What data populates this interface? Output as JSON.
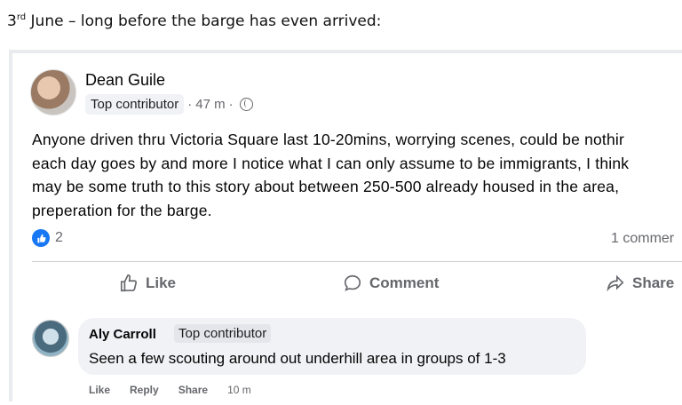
{
  "caption": {
    "date": "3",
    "suffix": "rd",
    "rest": " June – long before the barge has even arrived:"
  },
  "post": {
    "author": "Dean Guile",
    "badge": "Top contributor",
    "time": "47 m",
    "text_lines": [
      "Anyone driven thru Victoria Square last 10-20mins, worrying scenes, could be nothir",
      "each day goes by and more I notice what I can only assume to be immigrants, I think",
      "may be some truth to this story about between 250-500 already housed in the area,",
      "preperation for the barge."
    ],
    "like_count": "2",
    "comment_count": "1 commer",
    "actions": {
      "like": "Like",
      "comment": "Comment",
      "share": "Share"
    }
  },
  "comment": {
    "author": "Aly Carroll",
    "badge": "Top contributor",
    "text": "Seen a few scouting around out underhill area in groups of 1-3",
    "actions": {
      "like": "Like",
      "reply": "Reply",
      "share": "Share",
      "time": "10 m"
    }
  },
  "colors": {
    "accent": "#1877f2",
    "muted": "#65676b",
    "bubble": "#f0f2f5"
  },
  "icons": [
    "thumbs-up-icon",
    "speech-bubble-icon",
    "share-arrow-icon",
    "globe-icon",
    "like-reaction-icon"
  ]
}
